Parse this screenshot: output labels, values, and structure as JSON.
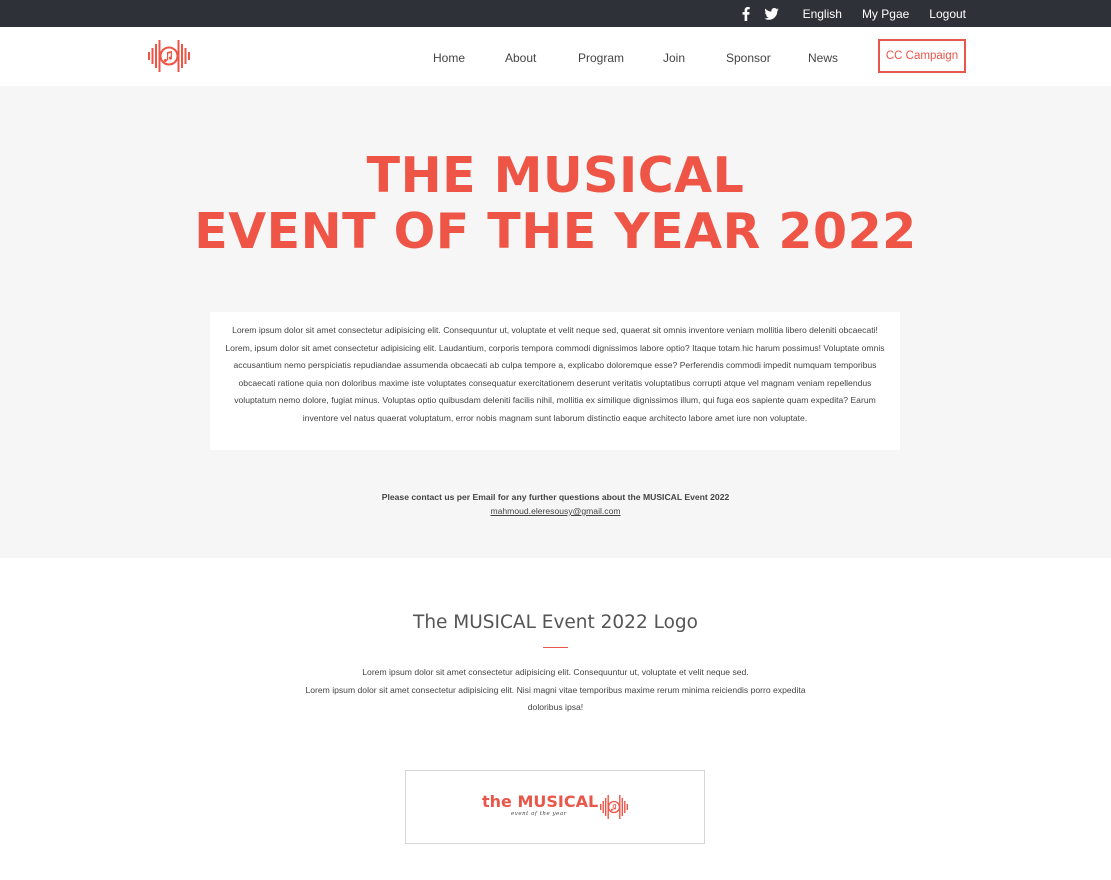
{
  "topbar": {
    "social": [
      {
        "name": "facebook-icon"
      },
      {
        "name": "twitter-icon"
      }
    ],
    "links": [
      "English",
      "My Pgae",
      "Logout"
    ]
  },
  "nav": {
    "items": [
      "Home",
      "About",
      "Program",
      "Join",
      "Sponsor",
      "News"
    ],
    "cta": "CC Campaign"
  },
  "hero": {
    "title_line1": "THE MUSICAL",
    "title_line2": "EVENT OF THE YEAR 2022",
    "body": "Lorem ipsum dolor sit amet consectetur adipisicing elit. Consequuntur ut, voluptate et velit neque sed, quaerat sit omnis inventore veniam mollitia libero deleniti obcaecati! Lorem, ipsum dolor sit amet consectetur adipisicing elit. Laudantium, corporis tempora commodi dignissimos labore optio? Itaque totam hic harum possimus! Voluptate omnis accusantium nemo perspiciatis repudiandae assumenda obcaecati ab culpa tempore a, explicabo doloremque esse? Perferendis commodi impedit numquam temporibus obcaecati ratione quia non doloribus maxime iste voluptates consequatur exercitationem deserunt veritatis voluptatibus corrupti atque vel magnam veniam repellendus voluptatum nemo dolore, fugiat minus. Voluptas optio quibusdam deleniti facilis nihil, mollitia ex similique dignissimos illum, qui fuga eos sapiente quam expedita? Earum inventore vel natus quaerat voluptatum, error nobis magnam sunt laborum distinctio eaque architecto labore amet iure non voluptate.",
    "contact_text": "Please contact us per Email for any further questions about the MUSICAL Event 2022",
    "contact_email": "mahmoud.eleresousy@gmail.com"
  },
  "logo_section": {
    "title": "The MUSICAL Event 2022 Logo",
    "line1": "Lorem ipsum dolor sit amet consectetur adipisicing elit. Consequuntur ut, voluptate et velit neque sed.",
    "line2": "Lorem ipsum dolor sit amet consectetur adipisicing elit. Nisi magni vitae temporibus maxime rerum minima reiciendis porro expedita doloribus ipsa!",
    "card_brand_the": "the",
    "card_brand_main": "MUSICAL",
    "card_sub": "event of the year"
  },
  "colors": {
    "accent": "#ee5546",
    "topbar_bg": "#2e3138",
    "hero_bg": "#f6f6f6"
  }
}
